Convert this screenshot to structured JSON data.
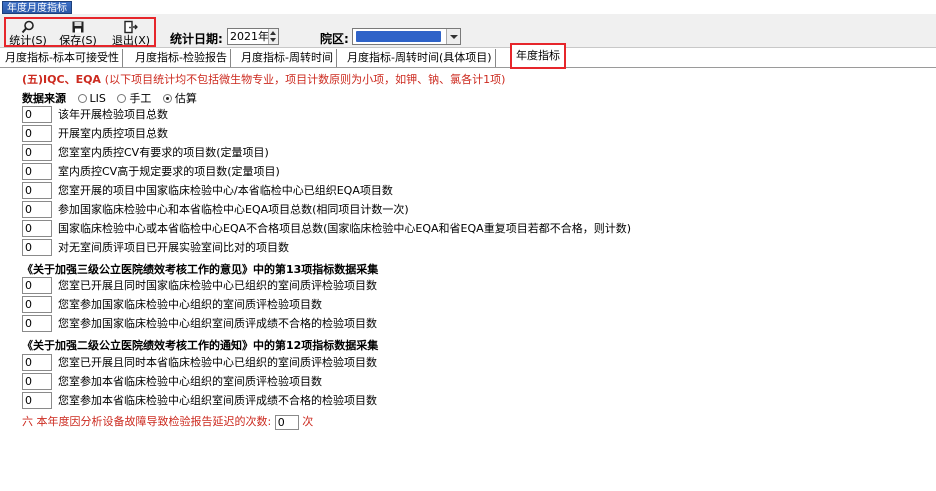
{
  "window": {
    "tab_title": "年度月度指标"
  },
  "toolbar": {
    "buttons": [
      {
        "label": "统计(S)"
      },
      {
        "label": "保存(S)"
      },
      {
        "label": "退出(X)"
      }
    ],
    "date_label": "统计日期:",
    "year_value": "2021年",
    "hospital_label": "院区:"
  },
  "tabs": [
    {
      "label": "月度指标-标本可接受性"
    },
    {
      "label": "月度指标-检验报告"
    },
    {
      "label": "月度指标-周转时间"
    },
    {
      "label": "月度指标-周转时间(具体项目)"
    },
    {
      "label": "年度指标"
    }
  ],
  "section5": {
    "title": "(五)IQC、EQA",
    "note": "(以下项目统计均不包括微生物专业，项目计数原则为小项，如钾、钠、氯各计1项)"
  },
  "data_source": {
    "label": "数据来源",
    "options": [
      "LIS",
      "手工",
      "估算"
    ],
    "selected": "估算"
  },
  "items_a": [
    {
      "value": "0",
      "label": "该年开展检验项目总数"
    },
    {
      "value": "0",
      "label": "开展室内质控项目总数"
    },
    {
      "value": "0",
      "label": "您室室内质控CV有要求的项目数(定量项目)"
    },
    {
      "value": "0",
      "label": "室内质控CV高于规定要求的项目数(定量项目)"
    },
    {
      "value": "0",
      "label": "您室开展的项目中国家临床检验中心/本省临检中心已组织EQA项目数"
    },
    {
      "value": "0",
      "label": "参加国家临床检验中心和本省临检中心EQA项目总数(相同项目计数一次)"
    },
    {
      "value": "0",
      "label": "国家临床检验中心或本省临检中心EQA不合格项目总数(国家临床检验中心EQA和省EQA重复项目若都不合格，则计数)"
    },
    {
      "value": "0",
      "label": "对无室间质评项目已开展实验室间比对的项目数"
    }
  ],
  "section_b_title": "《关于加强三级公立医院绩效考核工作的意见》中的第13项指标数据采集",
  "items_b": [
    {
      "value": "0",
      "label": "您室已开展且同时国家临床检验中心已组织的室间质评检验项目数"
    },
    {
      "value": "0",
      "label": "您室参加国家临床检验中心组织的室间质评检验项目数"
    },
    {
      "value": "0",
      "label": "您室参加国家临床检验中心组织室间质评成绩不合格的检验项目数"
    }
  ],
  "section_c_title": "《关于加强二级公立医院绩效考核工作的通知》中的第12项指标数据采集",
  "items_c": [
    {
      "value": "0",
      "label": "您室已开展且同时本省临床检验中心已组织的室间质评检验项目数"
    },
    {
      "value": "0",
      "label": "您室参加本省临床检验中心组织的室间质评检验项目数"
    },
    {
      "value": "0",
      "label": "您室参加本省临床检验中心组织室间质评成绩不合格的检验项目数"
    }
  ],
  "section6": {
    "label": "六 本年度因分析设备故障导致检验报告延迟的次数:",
    "value": "0",
    "unit": "次"
  }
}
